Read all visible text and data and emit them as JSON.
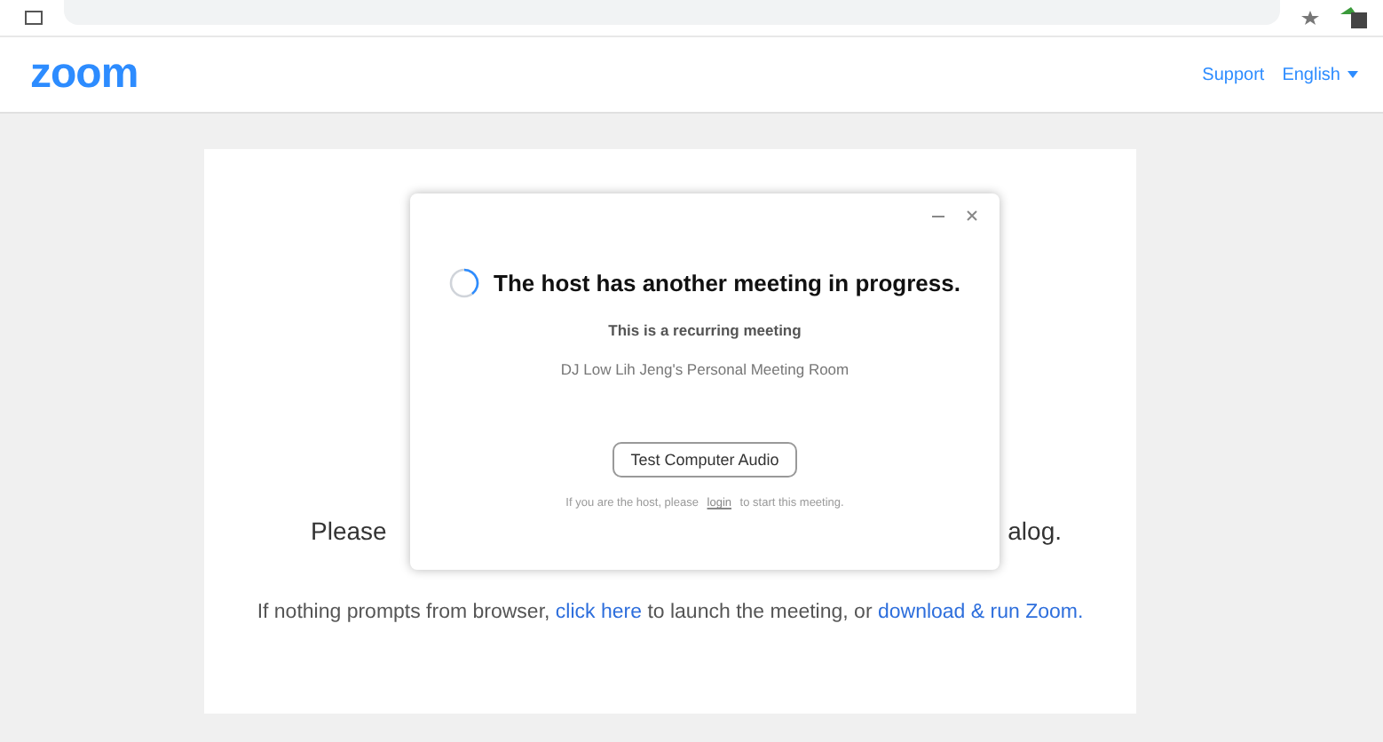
{
  "header": {
    "logo": "zoom",
    "links": [
      {
        "label": "Support",
        "dropdown": false
      },
      {
        "label": "English",
        "dropdown": true
      }
    ]
  },
  "card": {
    "line_left": "Please",
    "line_right": "alog.",
    "hint": [
      {
        "kind": "text",
        "text": "If nothing prompts from browser, "
      },
      {
        "kind": "link",
        "text": "click here"
      },
      {
        "kind": "text",
        "text": " to launch the meeting, or "
      },
      {
        "kind": "link",
        "text": "download & run Zoom."
      }
    ]
  },
  "dialog": {
    "title": "The host has another meeting in progress.",
    "subtitle": "This is a recurring meeting",
    "room": "DJ Low Lih Jeng's Personal Meeting Room",
    "button": "Test Computer Audio",
    "footer_before": "If you are the host, please",
    "footer_link": "login",
    "footer_after": "to start this meeting."
  }
}
